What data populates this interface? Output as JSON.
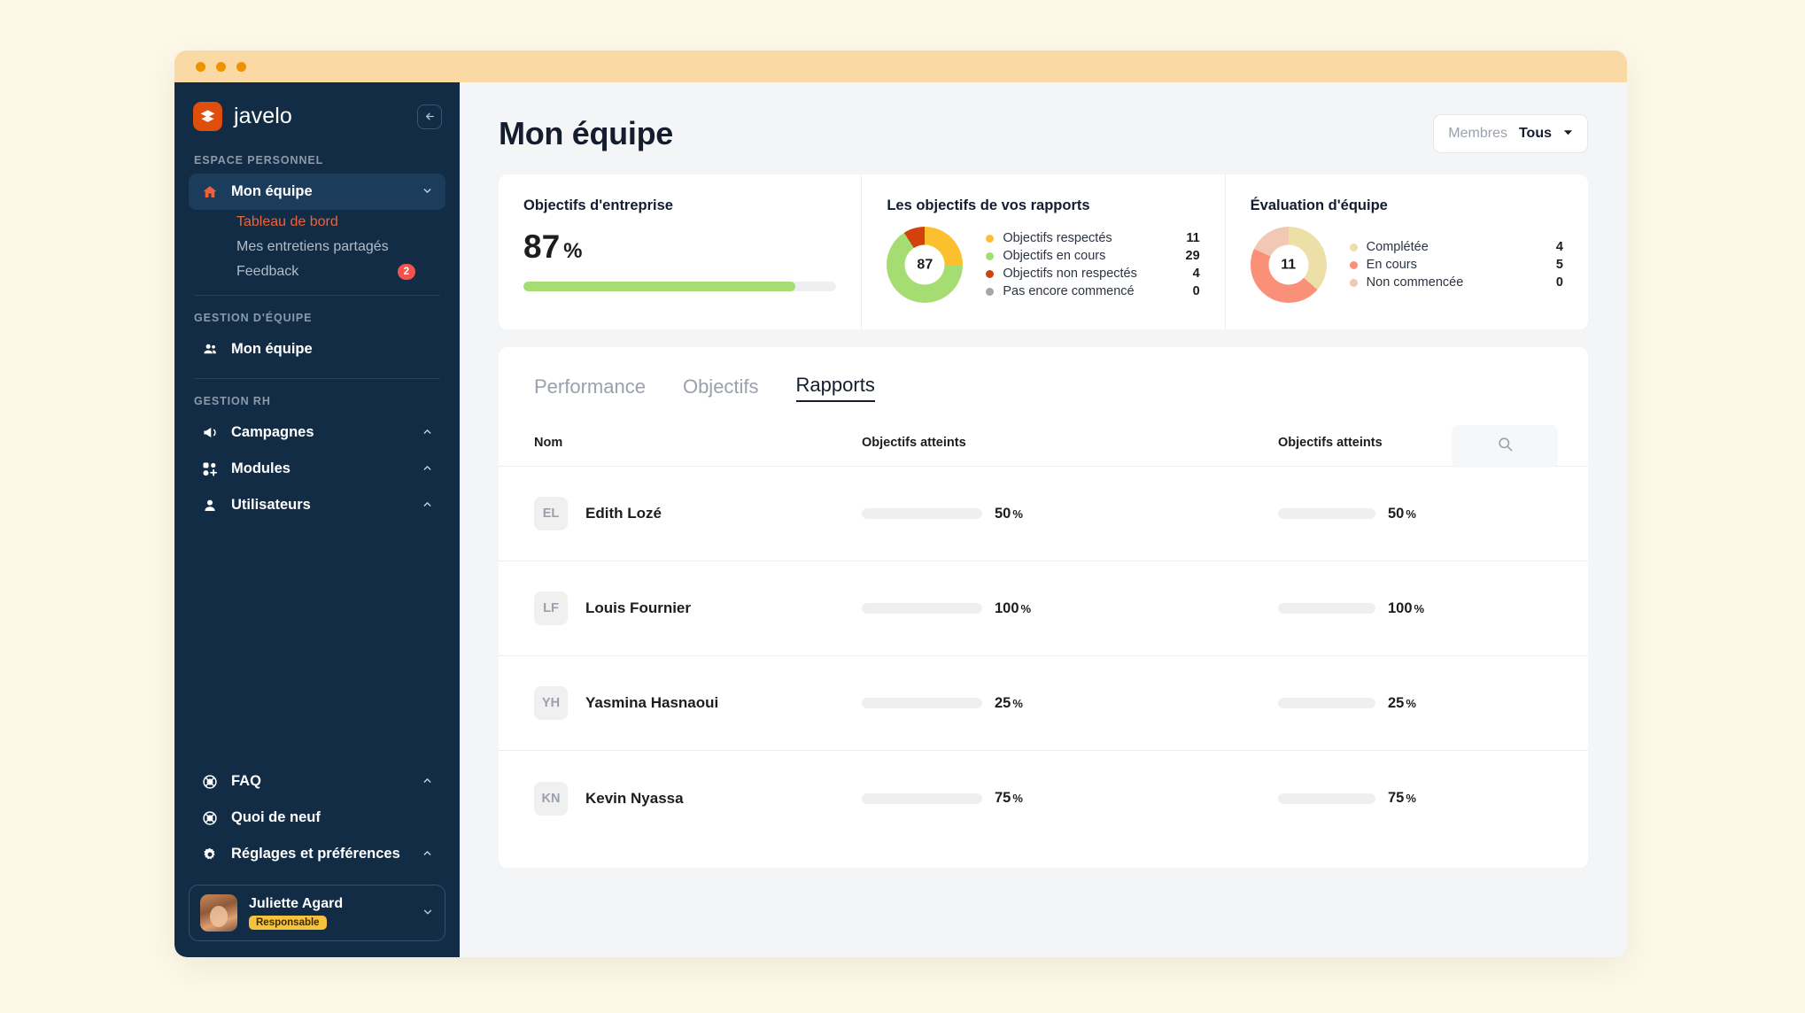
{
  "window": {
    "dots": 3
  },
  "sidebar": {
    "brand": {
      "name": "javelo",
      "logo_icon": "javelo-stack-logo",
      "collapse_icon": "arrow-left-icon"
    },
    "sections": [
      {
        "label": "ESPACE PERSONNEL",
        "items": [
          {
            "label": "Mon équipe",
            "icon": "home-icon",
            "active": true,
            "chevron": "chevron-down-icon"
          }
        ],
        "subitems": [
          {
            "label": "Tableau de bord",
            "selected": true
          },
          {
            "label": "Mes entretiens partagés",
            "selected": false
          },
          {
            "label": "Feedback",
            "selected": false,
            "badge": "2"
          }
        ]
      },
      {
        "label": "GESTION D'ÉQUIPE",
        "items": [
          {
            "label": "Mon équipe",
            "icon": "people-icon",
            "active": false,
            "chevron": ""
          }
        ],
        "subitems": []
      },
      {
        "label": "GESTION RH",
        "items": [
          {
            "label": "Campagnes",
            "icon": "megaphone-icon",
            "active": false,
            "chevron": "chevron-up-icon"
          },
          {
            "label": "Modules",
            "icon": "modules-grid-icon",
            "active": false,
            "chevron": "chevron-up-icon"
          },
          {
            "label": "Utilisateurs",
            "icon": "user-icon",
            "active": false,
            "chevron": "chevron-up-icon"
          }
        ],
        "subitems": []
      }
    ],
    "bottom_items": [
      {
        "label": "FAQ",
        "icon": "lifebuoy-icon",
        "chevron": "chevron-up-icon"
      },
      {
        "label": "Quoi de neuf",
        "icon": "lifebuoy-icon",
        "chevron": ""
      },
      {
        "label": "Réglages et préférences",
        "icon": "gear-icon",
        "chevron": "chevron-up-icon"
      }
    ],
    "user": {
      "name": "Juliette Agard",
      "role": "Responsable",
      "chevron": "chevron-down-icon",
      "role_bg": "#f5c33b"
    }
  },
  "header": {
    "title": "Mon équipe",
    "filter": {
      "label": "Membres",
      "value": "Tous",
      "caret": "caret-down-icon"
    }
  },
  "cards": {
    "company": {
      "title": "Objectifs d'entreprise",
      "value": "87",
      "symbol": "%",
      "progress": 87,
      "bar_color": "#a5dd72"
    },
    "reports": {
      "title": "Les objectifs de vos rapports",
      "center": "87",
      "legend": [
        {
          "label": "Objectifs respectés",
          "value": "11",
          "color": "#fcc02e"
        },
        {
          "label": "Objectifs en cours",
          "value": "29",
          "color": "#a5dd72"
        },
        {
          "label": "Objectifs non respectés",
          "value": "4",
          "color": "#d2420c"
        },
        {
          "label": "Pas encore commencé",
          "value": "0",
          "color": "#a6a6a6"
        }
      ]
    },
    "evaluation": {
      "title": "Évaluation d'équipe",
      "center": "11",
      "legend": [
        {
          "label": "Complétée",
          "value": "4",
          "color": "#ecdfa8"
        },
        {
          "label": "En cours",
          "value": "5",
          "color": "#fb9079"
        },
        {
          "label": "Non commencée",
          "value": "0",
          "color": "#f0c8b4"
        }
      ]
    }
  },
  "chart_data": [
    {
      "type": "pie",
      "title": "Les objectifs de vos rapports",
      "center_label": "87",
      "categories": [
        "Objectifs respectés",
        "Objectifs en cours",
        "Objectifs non respectés",
        "Pas encore commencé"
      ],
      "values": [
        11,
        29,
        4,
        0
      ],
      "colors": [
        "#fcc02e",
        "#a5dd72",
        "#d2420c",
        "#a6a6a6"
      ],
      "legend": "right"
    },
    {
      "type": "pie",
      "title": "Évaluation d'équipe",
      "center_label": "11",
      "categories": [
        "Complétée",
        "En cours",
        "Non commencée"
      ],
      "values": [
        4,
        5,
        2
      ],
      "colors": [
        "#ecdfa8",
        "#fb9079",
        "#f0c8b4"
      ],
      "legend": "right"
    },
    {
      "type": "bar",
      "title": "Objectifs d'entreprise",
      "categories": [
        "Objectifs d'entreprise"
      ],
      "values": [
        87
      ],
      "ylim": [
        0,
        100
      ],
      "ylabel": "%"
    }
  ],
  "panel": {
    "tabs": [
      {
        "label": "Performance",
        "active": false
      },
      {
        "label": "Objectifs",
        "active": false
      },
      {
        "label": "Rapports",
        "active": true
      }
    ],
    "search": {
      "icon": "search-icon",
      "placeholder": ""
    },
    "columns": [
      "Nom",
      "Objectifs atteints",
      "Objectifs atteints"
    ],
    "rows": [
      {
        "initials": "EL",
        "name": "Edith Lozé",
        "c1": {
          "pct": "50",
          "sym": "%",
          "value": 50,
          "color": "#fcc02e"
        },
        "c2": {
          "pct": "50",
          "sym": "%",
          "value": 50,
          "color": "#fcc02e"
        }
      },
      {
        "initials": "LF",
        "name": "Louis Fournier",
        "c1": {
          "pct": "100",
          "sym": "%",
          "value": 100,
          "color": "#a5dd72"
        },
        "c2": {
          "pct": "100",
          "sym": "%",
          "value": 100,
          "color": "#a5dd72"
        }
      },
      {
        "initials": "YH",
        "name": "Yasmina Hasnaoui",
        "c1": {
          "pct": "25",
          "sym": "%",
          "value": 25,
          "color": "#fcc02e"
        },
        "c2": {
          "pct": "25",
          "sym": "%",
          "value": 25,
          "color": "#fcc02e"
        }
      },
      {
        "initials": "KN",
        "name": "Kevin Nyassa",
        "c1": {
          "pct": "75",
          "sym": "%",
          "value": 75,
          "color": "#a5dd72"
        },
        "c2": {
          "pct": "75",
          "sym": "%",
          "value": 75,
          "color": "#a5dd72"
        }
      }
    ]
  }
}
